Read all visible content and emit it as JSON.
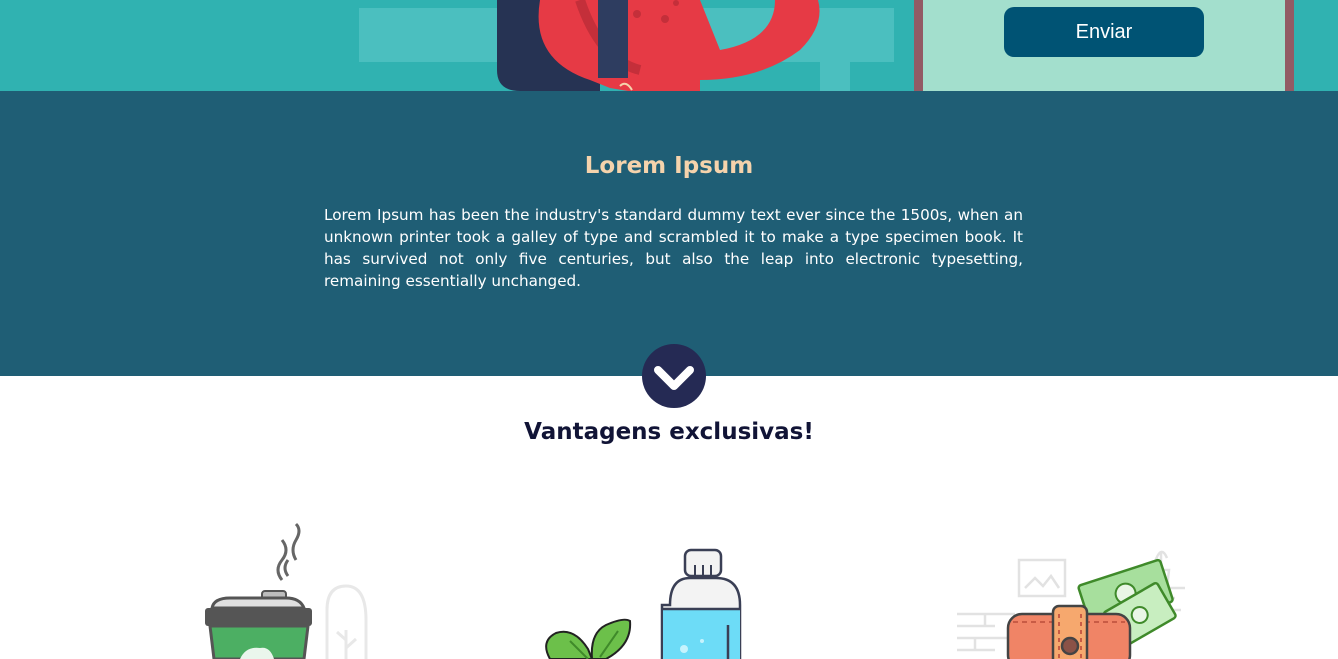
{
  "contact_form": {
    "submit_label": "Enviar"
  },
  "about": {
    "title": "Lorem Ipsum",
    "body": "Lorem Ipsum has been the industry's standard dummy text ever since the 1500s, when an unknown printer took a galley of type and scrambled it to make a type specimen book. It has survived not only five centuries, but also the leap into electronic typesetting, remaining essentially unchanged."
  },
  "scroll_down": {
    "icon": "chevron-down-icon"
  },
  "advantages": {
    "title": "Vantagens exclusivas!",
    "items": [
      {
        "icon": "coffee-cup-icon"
      },
      {
        "icon": "water-bottle-icon"
      },
      {
        "icon": "wallet-icon"
      }
    ]
  },
  "colors": {
    "hero_bg": "#30b2b1",
    "about_bg": "#1f5e75",
    "about_title": "#f5d3ac",
    "button_bg": "#005374",
    "form_bg": "#a3dfcd",
    "form_border": "#925b65",
    "heading_dark": "#111436"
  }
}
